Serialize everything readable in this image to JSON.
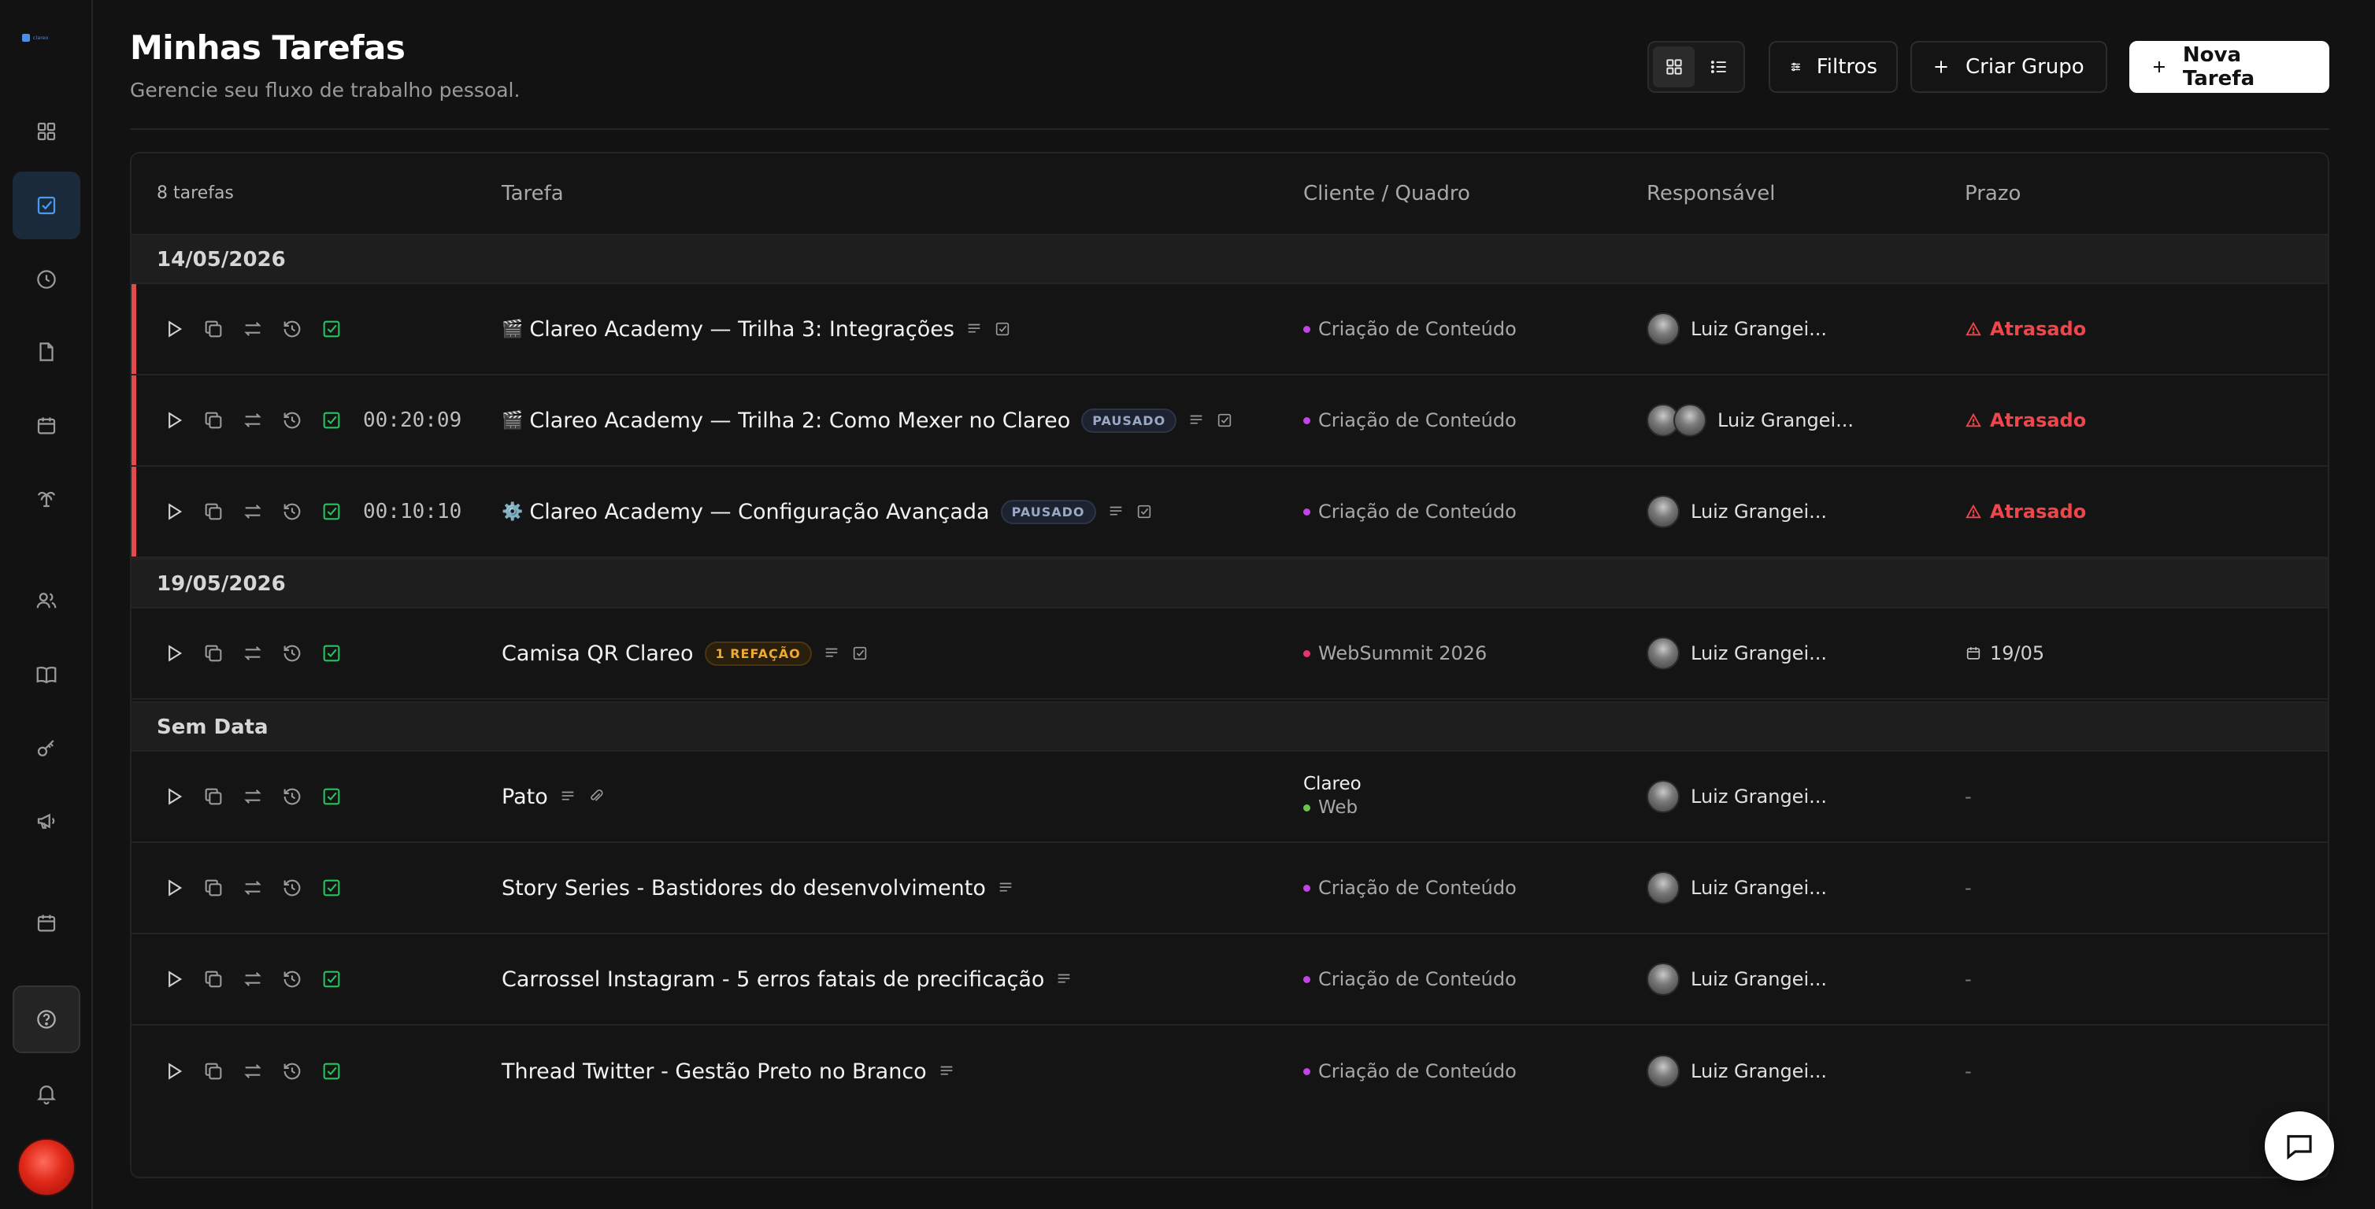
{
  "colors": {
    "accent_blue": "#4a8fe8",
    "late_red": "#f0454a",
    "done_green": "#22c55e",
    "client_purple": "#c243e6",
    "client_pink": "#e8336f",
    "client_green": "#6cc24a",
    "refacao_amber": "#f0a92a"
  },
  "header": {
    "title": "Minhas Tarefas",
    "subtitle": "Gerencie seu fluxo de trabalho pessoal.",
    "filters_label": "Filtros",
    "create_group_label": "Criar Grupo",
    "new_task_label": "Nova Tarefa"
  },
  "sidebar": {
    "items": [
      {
        "icon": "grid-icon"
      },
      {
        "icon": "checkbox-icon",
        "active": true
      },
      {
        "icon": "clock-icon"
      },
      {
        "icon": "file-icon"
      },
      {
        "icon": "calendar-icon"
      },
      {
        "icon": "palm-icon"
      },
      {
        "icon": "users-icon"
      },
      {
        "icon": "book-icon"
      },
      {
        "icon": "key-icon"
      },
      {
        "icon": "megaphone-icon"
      },
      {
        "icon": "calendar-icon"
      },
      {
        "icon": "help-icon"
      },
      {
        "icon": "bell-icon"
      }
    ]
  },
  "table": {
    "count": "8 tarefas",
    "columns": {
      "task": "Tarefa",
      "client": "Cliente / Quadro",
      "owner": "Responsável",
      "deadline": "Prazo"
    },
    "groups": [
      {
        "label": "14/05/2026",
        "rows": [
          {
            "emoji": "🎬",
            "title": "Clareo Academy — Trilha 3: Integrações",
            "timer": "",
            "badge": "",
            "client": "Criação de Conteúdo",
            "owner": "Luiz Grangei...",
            "deadline": "Atrasado"
          },
          {
            "emoji": "🎬",
            "title": "Clareo Academy — Trilha 2: Como Mexer no Clareo",
            "timer": "00:20:09",
            "badge": "PAUSADO",
            "client": "Criação de Conteúdo",
            "owner": "Luiz Grangei...",
            "deadline": "Atrasado"
          },
          {
            "emoji": "⚙️",
            "title": "Clareo Academy — Configuração Avançada",
            "timer": "00:10:10",
            "badge": "PAUSADO",
            "client": "Criação de Conteúdo",
            "owner": "Luiz Grangei...",
            "deadline": "Atrasado"
          }
        ]
      },
      {
        "label": "19/05/2026",
        "rows": [
          {
            "title": "Camisa QR Clareo",
            "badge": "1 REFAÇÃO",
            "client": "WebSummit 2026",
            "owner": "Luiz Grangei...",
            "deadline": "19/05"
          }
        ]
      },
      {
        "label": "Sem Data",
        "rows": [
          {
            "title": "Pato",
            "client_name": "Clareo",
            "client": "Web",
            "owner": "Luiz Grangei...",
            "deadline": "-"
          },
          {
            "title": "Story Series - Bastidores do desenvolvimento",
            "client": "Criação de Conteúdo",
            "owner": "Luiz Grangei...",
            "deadline": "-"
          },
          {
            "title": "Carrossel Instagram - 5 erros fatais de precificação",
            "client": "Criação de Conteúdo",
            "owner": "Luiz Grangei...",
            "deadline": "-"
          },
          {
            "title": "Thread Twitter - Gestão Preto no Branco",
            "client": "Criação de Conteúdo",
            "owner": "Luiz Grangei...",
            "deadline": "-"
          }
        ]
      }
    ]
  }
}
